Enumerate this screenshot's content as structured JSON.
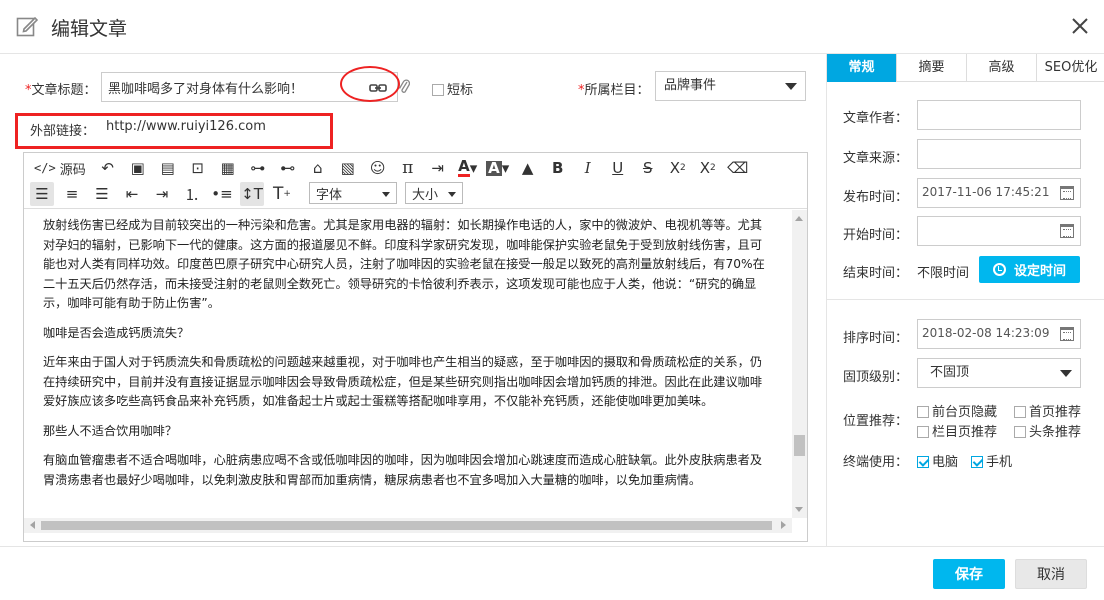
{
  "window": {
    "title": "编辑文章"
  },
  "form": {
    "title_label": "文章标题：",
    "title_value": "黑咖啡喝多了对身体有什么影响！",
    "shortcut_label": "短标",
    "column_label": "所属栏目：",
    "column_value": "品牌事件",
    "external_link_label": "外部链接：",
    "external_link_value": "http://www.ruiyi126.com"
  },
  "toolbar": {
    "source_label": "源码",
    "font_label": "字体",
    "size_label": "大小",
    "t_plain": "T",
    "t_big": "T"
  },
  "content": {
    "paragraphs": [
      "放射线伤害已经成为目前较突出的一种污染和危害。尤其是家用电器的辐射：如长期操作电话的人，家中的微波炉、电视机等等。尤其对孕妇的辐射，已影响下一代的健康。这方面的报道屡见不鲜。印度科学家研究发现，咖啡能保护实验老鼠免于受到放射线伤害，且可能也对人类有同样功效。印度芭巴原子研究中心研究人员，注射了咖啡因的实验老鼠在接受一般足以致死的高剂量放射线后，有70%在二十五天后仍然存活，而未接受注射的老鼠则全数死亡。领导研究的卡恰彼利乔表示，这项发现可能也应于人类，他说：“研究的确显示，咖啡可能有助于防止伤害”。",
      "咖啡是否会造成钙质流失？",
      "近年来由于国人对于钙质流失和骨质疏松的问题越来越重视，对于咖啡也产生相当的疑惑，至于咖啡因的摄取和骨质疏松症的关系，仍在持续研究中，目前并没有直接证据显示咖啡因会导致骨质疏松症，但是某些研究则指出咖啡因会增加钙质的排泄。因此在此建议咖啡爱好族应该多吃些高钙食品来补充钙质，如准备起士片或起士蛋糕等搭配咖啡享用，不仅能补充钙质，还能使咖啡更加美味。",
      "那些人不适合饮用咖啡？",
      "有脑血管瘤患者不适合喝咖啡，心脏病患应喝不含或低咖啡因的咖啡，因为咖啡因会增加心跳速度而造成心脏缺氧。此外皮肤病患者及胃溃疡患者也最好少喝咖啡，以免刺激皮肤和胃部而加重病情，糖尿病患者也不宜多喝加入大量糖的咖啡，以免加重病情。"
    ]
  },
  "side": {
    "tabs": [
      "常规",
      "摘要",
      "高级",
      "SEO优化"
    ],
    "author_label": "文章作者：",
    "author_value": "",
    "source_label": "文章来源：",
    "source_value": "",
    "publish_label": "发布时间：",
    "publish_value": "2017-11-06 17:45:21",
    "start_label": "开始时间：",
    "start_value": "",
    "end_label": "结束时间：",
    "end_value": "不限时间",
    "set_time_label": "设定时间",
    "sort_label": "排序时间：",
    "sort_value": "2018-02-08 14:23:09",
    "pin_label": "固顶级别：",
    "pin_value": "不固顶",
    "position_label": "位置推荐：",
    "position_options": [
      "前台页隐藏",
      "首页推荐",
      "栏目页推荐",
      "头条推荐"
    ],
    "terminal_label": "终端使用：",
    "terminal_options": [
      "电脑",
      "手机"
    ]
  },
  "footer": {
    "save_label": "保存",
    "cancel_label": "取消"
  },
  "colors": {
    "accent": "#00b7ee",
    "tab_active": "#00a7e1",
    "highlight": "#ee2222"
  }
}
